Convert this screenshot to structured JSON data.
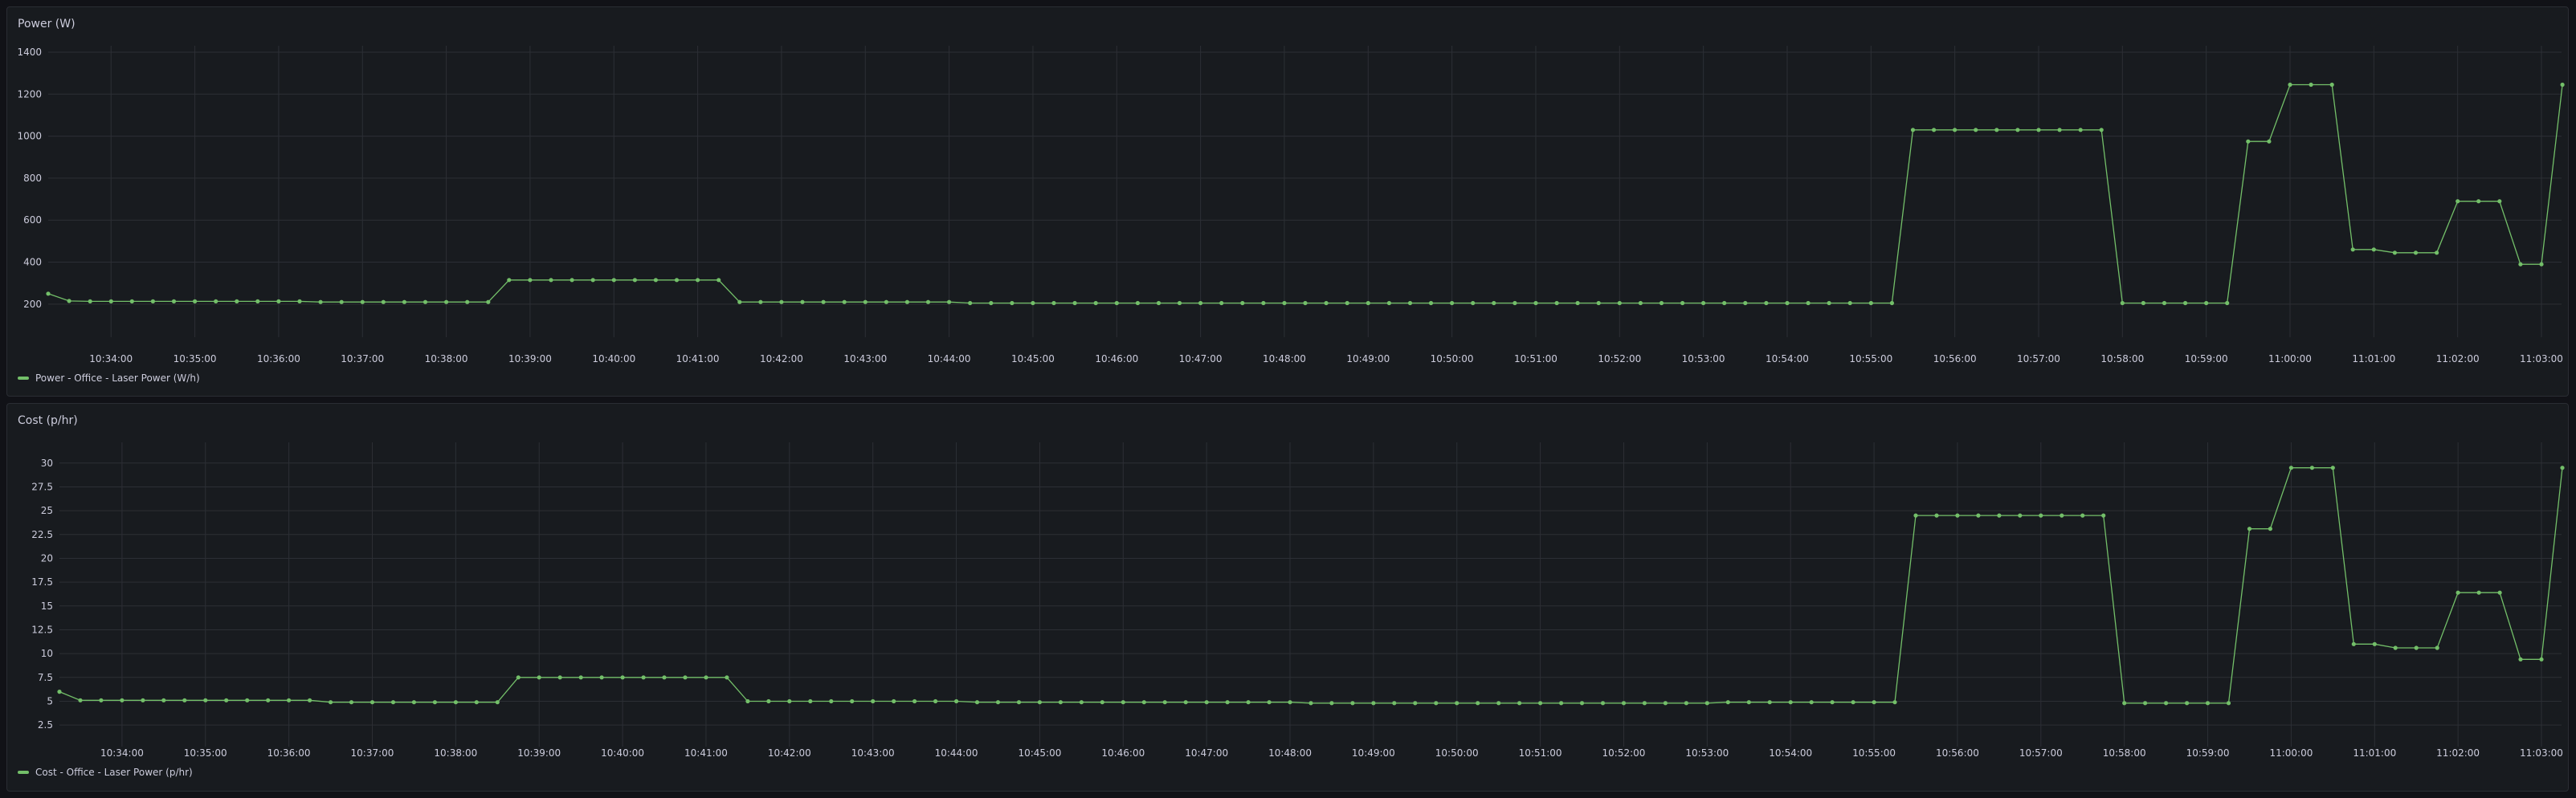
{
  "colors": {
    "series": "#73bf69",
    "grid": "#2c2f35",
    "text": "#ccccdc",
    "panel_bg": "#181b1f",
    "page_bg": "#111217"
  },
  "panels": [
    {
      "title": "Power (W)",
      "legend": "Power - Office - Laser Power (W/h)"
    },
    {
      "title": "Cost (p/hr)",
      "legend": "Cost - Office - Laser Power (p/hr)"
    }
  ],
  "chart_data": [
    {
      "type": "line",
      "title": "Power (W)",
      "xlabel": "",
      "ylabel": "",
      "grid": true,
      "legend_placement": "bottom-left",
      "ylim": [
        100,
        1400
      ],
      "y_ticks": [
        200,
        400,
        600,
        800,
        1000,
        1200,
        1400
      ],
      "x_range": [
        "10:33:15",
        "11:03:00"
      ],
      "x_ticks": [
        "10:34:00",
        "10:35:00",
        "10:36:00",
        "10:37:00",
        "10:38:00",
        "10:39:00",
        "10:40:00",
        "10:41:00",
        "10:42:00",
        "10:43:00",
        "10:44:00",
        "10:45:00",
        "10:46:00",
        "10:47:00",
        "10:48:00",
        "10:49:00",
        "10:50:00",
        "10:51:00",
        "10:52:00",
        "10:53:00",
        "10:54:00",
        "10:55:00",
        "10:56:00",
        "10:57:00",
        "10:58:00",
        "10:59:00",
        "11:00:00",
        "11:01:00",
        "11:02:00",
        "11:03:00"
      ],
      "series": [
        {
          "name": "Power - Office - Laser Power (W/h)",
          "x_start": "10:33:15",
          "interval_seconds": 15,
          "values": [
            250,
            215,
            213,
            213,
            213,
            213,
            213,
            213,
            213,
            213,
            213,
            213,
            213,
            210,
            210,
            210,
            210,
            210,
            210,
            210,
            210,
            210,
            315,
            315,
            315,
            315,
            315,
            315,
            315,
            315,
            315,
            315,
            315,
            210,
            210,
            210,
            210,
            210,
            210,
            210,
            210,
            210,
            210,
            210,
            205,
            205,
            205,
            205,
            205,
            205,
            205,
            205,
            205,
            205,
            205,
            205,
            205,
            205,
            205,
            205,
            205,
            205,
            205,
            205,
            205,
            205,
            205,
            205,
            205,
            205,
            205,
            205,
            205,
            205,
            205,
            205,
            205,
            205,
            205,
            205,
            205,
            205,
            205,
            205,
            205,
            205,
            205,
            205,
            205,
            1030,
            1030,
            1030,
            1030,
            1030,
            1030,
            1030,
            1030,
            1030,
            1030,
            205,
            205,
            205,
            205,
            205,
            205,
            975,
            975,
            1245,
            1245,
            1245,
            460,
            460,
            445,
            445,
            445,
            690,
            690,
            690,
            390,
            390,
            1245
          ]
        }
      ]
    },
    {
      "type": "line",
      "title": "Cost (p/hr)",
      "xlabel": "",
      "ylabel": "",
      "grid": true,
      "legend_placement": "bottom-left",
      "ylim": [
        1.5,
        31.5
      ],
      "y_ticks": [
        2.5,
        5,
        7.5,
        10,
        12.5,
        15,
        17.5,
        20,
        22.5,
        25,
        27.5,
        30
      ],
      "x_range": [
        "10:33:15",
        "11:03:00"
      ],
      "x_ticks": [
        "10:34:00",
        "10:35:00",
        "10:36:00",
        "10:37:00",
        "10:38:00",
        "10:39:00",
        "10:40:00",
        "10:41:00",
        "10:42:00",
        "10:43:00",
        "10:44:00",
        "10:45:00",
        "10:46:00",
        "10:47:00",
        "10:48:00",
        "10:49:00",
        "10:50:00",
        "10:51:00",
        "10:52:00",
        "10:53:00",
        "10:54:00",
        "10:55:00",
        "10:56:00",
        "10:57:00",
        "10:58:00",
        "10:59:00",
        "11:00:00",
        "11:01:00",
        "11:02:00",
        "11:03:00"
      ],
      "series": [
        {
          "name": "Cost - Office - Laser Power (p/hr)",
          "x_start": "10:33:15",
          "interval_seconds": 15,
          "values": [
            6,
            5.1,
            5.1,
            5.1,
            5.1,
            5.1,
            5.1,
            5.1,
            5.1,
            5.1,
            5.1,
            5.1,
            5.1,
            4.9,
            4.9,
            4.9,
            4.9,
            4.9,
            4.9,
            4.9,
            4.9,
            4.9,
            7.5,
            7.5,
            7.5,
            7.5,
            7.5,
            7.5,
            7.5,
            7.5,
            7.5,
            7.5,
            7.5,
            5,
            5,
            5,
            5,
            5,
            5,
            5,
            5,
            5,
            5,
            5,
            4.9,
            4.9,
            4.9,
            4.9,
            4.9,
            4.9,
            4.9,
            4.9,
            4.9,
            4.9,
            4.9,
            4.9,
            4.9,
            4.9,
            4.9,
            4.9,
            4.8,
            4.8,
            4.8,
            4.8,
            4.8,
            4.8,
            4.8,
            4.8,
            4.8,
            4.8,
            4.8,
            4.8,
            4.8,
            4.8,
            4.8,
            4.8,
            4.8,
            4.8,
            4.8,
            4.8,
            4.9,
            4.9,
            4.9,
            4.9,
            4.9,
            4.9,
            4.9,
            4.9,
            4.9,
            24.5,
            24.5,
            24.5,
            24.5,
            24.5,
            24.5,
            24.5,
            24.5,
            24.5,
            24.5,
            4.8,
            4.8,
            4.8,
            4.8,
            4.8,
            4.8,
            23.1,
            23.1,
            29.5,
            29.5,
            29.5,
            11,
            11,
            10.6,
            10.6,
            10.6,
            16.4,
            16.4,
            16.4,
            9.4,
            9.4,
            29.5
          ]
        }
      ]
    }
  ]
}
